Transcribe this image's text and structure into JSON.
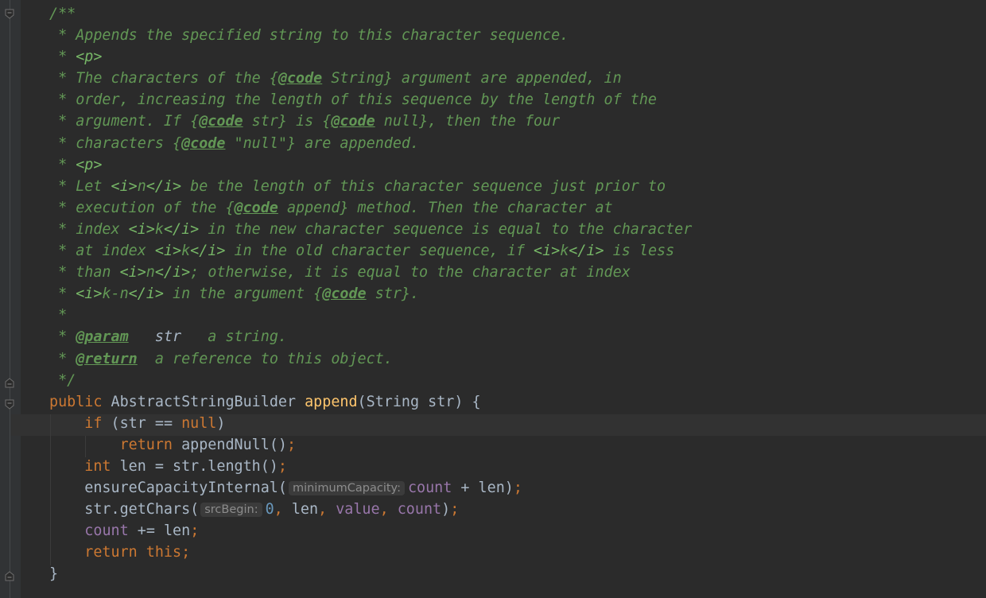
{
  "editor": {
    "doc_lines": [
      [
        {
          "t": "/**",
          "c": "doc"
        }
      ],
      [
        {
          "t": " * Appends the specified string to this character sequence.",
          "c": "doc"
        }
      ],
      [
        {
          "t": " * ",
          "c": "doc"
        },
        {
          "t": "<p>",
          "c": "docmarkup"
        }
      ],
      [
        {
          "t": " * The characters of the {",
          "c": "doc"
        },
        {
          "t": "@code",
          "c": "doctag"
        },
        {
          "t": " String} argument are appended, in",
          "c": "doc"
        }
      ],
      [
        {
          "t": " * order, increasing the length of this sequence by the length of the",
          "c": "doc"
        }
      ],
      [
        {
          "t": " * argument. If {",
          "c": "doc"
        },
        {
          "t": "@code",
          "c": "doctag"
        },
        {
          "t": " str} is {",
          "c": "doc"
        },
        {
          "t": "@code",
          "c": "doctag"
        },
        {
          "t": " null}, then the four",
          "c": "doc"
        }
      ],
      [
        {
          "t": " * characters {",
          "c": "doc"
        },
        {
          "t": "@code",
          "c": "doctag"
        },
        {
          "t": " \"null\"} are appended.",
          "c": "doc"
        }
      ],
      [
        {
          "t": " * ",
          "c": "doc"
        },
        {
          "t": "<p>",
          "c": "docmarkup"
        }
      ],
      [
        {
          "t": " * Let ",
          "c": "doc"
        },
        {
          "t": "<i>",
          "c": "docmarkup"
        },
        {
          "t": "n",
          "c": "doc"
        },
        {
          "t": "</i>",
          "c": "docmarkup"
        },
        {
          "t": " be the length of this character sequence just prior to",
          "c": "doc"
        }
      ],
      [
        {
          "t": " * execution of the {",
          "c": "doc"
        },
        {
          "t": "@code",
          "c": "doctag"
        },
        {
          "t": " append} method. Then the character at",
          "c": "doc"
        }
      ],
      [
        {
          "t": " * index ",
          "c": "doc"
        },
        {
          "t": "<i>",
          "c": "docmarkup"
        },
        {
          "t": "k",
          "c": "doc"
        },
        {
          "t": "</i>",
          "c": "docmarkup"
        },
        {
          "t": " in the new character sequence is equal to the character",
          "c": "doc"
        }
      ],
      [
        {
          "t": " * at index ",
          "c": "doc"
        },
        {
          "t": "<i>",
          "c": "docmarkup"
        },
        {
          "t": "k",
          "c": "doc"
        },
        {
          "t": "</i>",
          "c": "docmarkup"
        },
        {
          "t": " in the old character sequence, if ",
          "c": "doc"
        },
        {
          "t": "<i>",
          "c": "docmarkup"
        },
        {
          "t": "k",
          "c": "doc"
        },
        {
          "t": "</i>",
          "c": "docmarkup"
        },
        {
          "t": " is less",
          "c": "doc"
        }
      ],
      [
        {
          "t": " * than ",
          "c": "doc"
        },
        {
          "t": "<i>",
          "c": "docmarkup"
        },
        {
          "t": "n",
          "c": "doc"
        },
        {
          "t": "</i>",
          "c": "docmarkup"
        },
        {
          "t": "; otherwise, it is equal to the character at index",
          "c": "doc"
        }
      ],
      [
        {
          "t": " * ",
          "c": "doc"
        },
        {
          "t": "<i>",
          "c": "docmarkup"
        },
        {
          "t": "k-n",
          "c": "doc"
        },
        {
          "t": "</i>",
          "c": "docmarkup"
        },
        {
          "t": " in the argument {",
          "c": "doc"
        },
        {
          "t": "@code",
          "c": "doctag"
        },
        {
          "t": " str}.",
          "c": "doc"
        }
      ],
      [
        {
          "t": " *",
          "c": "doc"
        }
      ],
      [
        {
          "t": " * ",
          "c": "doc"
        },
        {
          "t": "@param",
          "c": "doctag"
        },
        {
          "t": "   ",
          "c": "doc"
        },
        {
          "t": "str",
          "c": "paramname"
        },
        {
          "t": "   a string.",
          "c": "doc"
        }
      ],
      [
        {
          "t": " * ",
          "c": "doc"
        },
        {
          "t": "@return",
          "c": "doctag"
        },
        {
          "t": "  a reference to this object.",
          "c": "doc"
        }
      ],
      [
        {
          "t": " */",
          "c": "doc"
        }
      ]
    ],
    "code_lines": [
      [
        {
          "t": "public ",
          "c": "kw"
        },
        {
          "t": "AbstractStringBuilder ",
          "c": ""
        },
        {
          "t": "append",
          "c": "fn"
        },
        {
          "t": "(String str) {",
          "c": ""
        }
      ],
      [
        {
          "t": "    if ",
          "c": "kw"
        },
        {
          "t": "(str == ",
          "c": ""
        },
        {
          "t": "null",
          "c": "kw"
        },
        {
          "t": ")",
          "c": ""
        }
      ],
      [
        {
          "t": "        return ",
          "c": "kw"
        },
        {
          "t": "appendNull()",
          "c": ""
        },
        {
          "t": ";",
          "c": "kw"
        }
      ],
      [
        {
          "t": "    int ",
          "c": "kw"
        },
        {
          "t": "len = str.length()",
          "c": ""
        },
        {
          "t": ";",
          "c": "kw"
        }
      ],
      [
        {
          "t": "    ensureCapacityInternal(",
          "c": ""
        },
        {
          "t": "minimumCapacity:",
          "c": "hint"
        },
        {
          "t": "count",
          "c": "field"
        },
        {
          "t": " + len)",
          "c": ""
        },
        {
          "t": ";",
          "c": "kw"
        }
      ],
      [
        {
          "t": "    str.getChars(",
          "c": ""
        },
        {
          "t": "srcBegin:",
          "c": "hint"
        },
        {
          "t": "0",
          "c": "num"
        },
        {
          "t": ", ",
          "c": "kw"
        },
        {
          "t": "len",
          "c": ""
        },
        {
          "t": ", ",
          "c": "kw"
        },
        {
          "t": "value",
          "c": "field"
        },
        {
          "t": ", ",
          "c": "kw"
        },
        {
          "t": "count",
          "c": "field"
        },
        {
          "t": ")",
          "c": ""
        },
        {
          "t": ";",
          "c": "kw"
        }
      ],
      [
        {
          "t": "    ",
          "c": ""
        },
        {
          "t": "count",
          "c": "field"
        },
        {
          "t": " += len",
          "c": ""
        },
        {
          "t": ";",
          "c": "kw"
        }
      ],
      [
        {
          "t": "    return this;",
          "c": "kw"
        }
      ],
      [
        {
          "t": "}",
          "c": ""
        }
      ]
    ]
  },
  "gutter": {
    "fold_icons": [
      "fold-start-icon",
      "fold-end-icon",
      "fold-start-icon",
      "fold-end-icon"
    ]
  },
  "theme": {
    "background": "#2b2b2b",
    "comment": "#629755",
    "keyword": "#cc7832",
    "method": "#ffc66d",
    "field": "#9876aa",
    "number": "#6897bb",
    "text": "#a9b7c6"
  }
}
